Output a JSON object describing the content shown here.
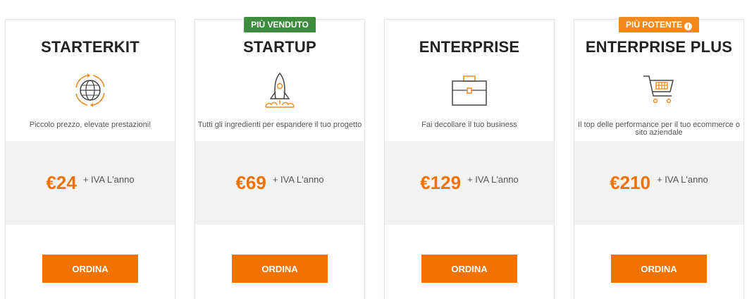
{
  "plans": [
    {
      "name": "STARTERKIT",
      "badge": "",
      "icon": "globe-icon",
      "tagline": "Piccolo prezzo, elevate prestazioni!",
      "price": "€24",
      "price_suffix": "+ IVA L'anno",
      "order_label": "ORDINA"
    },
    {
      "name": "STARTUP",
      "badge": "PIÙ VENDUTO",
      "icon": "rocket-icon",
      "tagline": "Tutti gli ingredienti per espandere il tuo progetto",
      "price": "€69",
      "price_suffix": "+ IVA L'anno",
      "order_label": "ORDINA"
    },
    {
      "name": "ENTERPRISE",
      "badge": "",
      "icon": "briefcase-icon",
      "tagline": "Fai decollare il tuo business",
      "price": "€129",
      "price_suffix": "+ IVA L'anno",
      "order_label": "ORDINA"
    },
    {
      "name": "ENTERPRISE PLUS",
      "badge": "PIÙ POTENTE",
      "icon": "shopping-cart-icon",
      "tagline": "Il top delle performance per il tuo ecommerce o sito aziendale",
      "price": "€210",
      "price_suffix": "+ IVA L'anno",
      "order_label": "ORDINA"
    }
  ],
  "colors": {
    "accent": "#f27200",
    "badge_green": "#3d8b3d",
    "badge_orange": "#f08a1d",
    "price_band": "#f2f2f2"
  }
}
